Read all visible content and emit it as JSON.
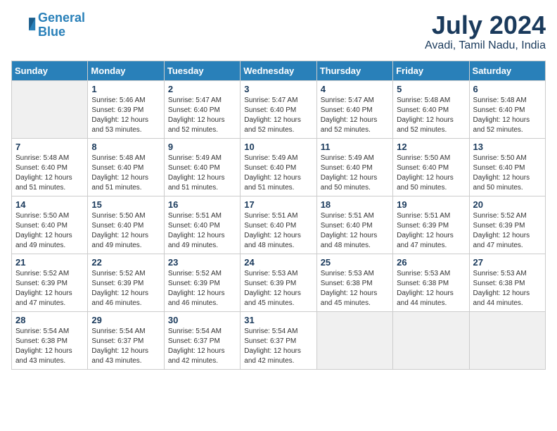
{
  "header": {
    "logo_line1": "General",
    "logo_line2": "Blue",
    "month_title": "July 2024",
    "location": "Avadi, Tamil Nadu, India"
  },
  "days_of_week": [
    "Sunday",
    "Monday",
    "Tuesday",
    "Wednesday",
    "Thursday",
    "Friday",
    "Saturday"
  ],
  "weeks": [
    [
      {
        "day": "",
        "empty": true
      },
      {
        "day": "1",
        "sunrise": "5:46 AM",
        "sunset": "6:39 PM",
        "daylight": "12 hours and 53 minutes."
      },
      {
        "day": "2",
        "sunrise": "5:47 AM",
        "sunset": "6:40 PM",
        "daylight": "12 hours and 52 minutes."
      },
      {
        "day": "3",
        "sunrise": "5:47 AM",
        "sunset": "6:40 PM",
        "daylight": "12 hours and 52 minutes."
      },
      {
        "day": "4",
        "sunrise": "5:47 AM",
        "sunset": "6:40 PM",
        "daylight": "12 hours and 52 minutes."
      },
      {
        "day": "5",
        "sunrise": "5:48 AM",
        "sunset": "6:40 PM",
        "daylight": "12 hours and 52 minutes."
      },
      {
        "day": "6",
        "sunrise": "5:48 AM",
        "sunset": "6:40 PM",
        "daylight": "12 hours and 52 minutes."
      }
    ],
    [
      {
        "day": "7",
        "sunrise": "5:48 AM",
        "sunset": "6:40 PM",
        "daylight": "12 hours and 51 minutes."
      },
      {
        "day": "8",
        "sunrise": "5:48 AM",
        "sunset": "6:40 PM",
        "daylight": "12 hours and 51 minutes."
      },
      {
        "day": "9",
        "sunrise": "5:49 AM",
        "sunset": "6:40 PM",
        "daylight": "12 hours and 51 minutes."
      },
      {
        "day": "10",
        "sunrise": "5:49 AM",
        "sunset": "6:40 PM",
        "daylight": "12 hours and 51 minutes."
      },
      {
        "day": "11",
        "sunrise": "5:49 AM",
        "sunset": "6:40 PM",
        "daylight": "12 hours and 50 minutes."
      },
      {
        "day": "12",
        "sunrise": "5:50 AM",
        "sunset": "6:40 PM",
        "daylight": "12 hours and 50 minutes."
      },
      {
        "day": "13",
        "sunrise": "5:50 AM",
        "sunset": "6:40 PM",
        "daylight": "12 hours and 50 minutes."
      }
    ],
    [
      {
        "day": "14",
        "sunrise": "5:50 AM",
        "sunset": "6:40 PM",
        "daylight": "12 hours and 49 minutes."
      },
      {
        "day": "15",
        "sunrise": "5:50 AM",
        "sunset": "6:40 PM",
        "daylight": "12 hours and 49 minutes."
      },
      {
        "day": "16",
        "sunrise": "5:51 AM",
        "sunset": "6:40 PM",
        "daylight": "12 hours and 49 minutes."
      },
      {
        "day": "17",
        "sunrise": "5:51 AM",
        "sunset": "6:40 PM",
        "daylight": "12 hours and 48 minutes."
      },
      {
        "day": "18",
        "sunrise": "5:51 AM",
        "sunset": "6:40 PM",
        "daylight": "12 hours and 48 minutes."
      },
      {
        "day": "19",
        "sunrise": "5:51 AM",
        "sunset": "6:39 PM",
        "daylight": "12 hours and 47 minutes."
      },
      {
        "day": "20",
        "sunrise": "5:52 AM",
        "sunset": "6:39 PM",
        "daylight": "12 hours and 47 minutes."
      }
    ],
    [
      {
        "day": "21",
        "sunrise": "5:52 AM",
        "sunset": "6:39 PM",
        "daylight": "12 hours and 47 minutes."
      },
      {
        "day": "22",
        "sunrise": "5:52 AM",
        "sunset": "6:39 PM",
        "daylight": "12 hours and 46 minutes."
      },
      {
        "day": "23",
        "sunrise": "5:52 AM",
        "sunset": "6:39 PM",
        "daylight": "12 hours and 46 minutes."
      },
      {
        "day": "24",
        "sunrise": "5:53 AM",
        "sunset": "6:39 PM",
        "daylight": "12 hours and 45 minutes."
      },
      {
        "day": "25",
        "sunrise": "5:53 AM",
        "sunset": "6:38 PM",
        "daylight": "12 hours and 45 minutes."
      },
      {
        "day": "26",
        "sunrise": "5:53 AM",
        "sunset": "6:38 PM",
        "daylight": "12 hours and 44 minutes."
      },
      {
        "day": "27",
        "sunrise": "5:53 AM",
        "sunset": "6:38 PM",
        "daylight": "12 hours and 44 minutes."
      }
    ],
    [
      {
        "day": "28",
        "sunrise": "5:54 AM",
        "sunset": "6:38 PM",
        "daylight": "12 hours and 43 minutes."
      },
      {
        "day": "29",
        "sunrise": "5:54 AM",
        "sunset": "6:37 PM",
        "daylight": "12 hours and 43 minutes."
      },
      {
        "day": "30",
        "sunrise": "5:54 AM",
        "sunset": "6:37 PM",
        "daylight": "12 hours and 42 minutes."
      },
      {
        "day": "31",
        "sunrise": "5:54 AM",
        "sunset": "6:37 PM",
        "daylight": "12 hours and 42 minutes."
      },
      {
        "day": "",
        "empty": true
      },
      {
        "day": "",
        "empty": true
      },
      {
        "day": "",
        "empty": true
      }
    ]
  ]
}
